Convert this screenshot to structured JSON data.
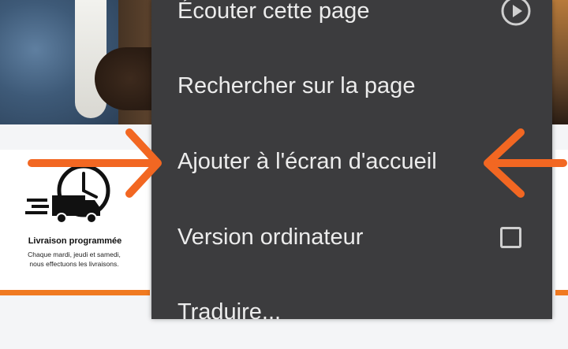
{
  "background_page": {
    "card": {
      "title": "Livraison programmée",
      "description": "Chaque mardi, jeudi et samedi, nous effectuons les livraisons."
    }
  },
  "menu": {
    "items": [
      {
        "label": "Écouter cette page",
        "trailing": "play-circle-icon"
      },
      {
        "label": "Rechercher sur la page"
      },
      {
        "label": "Ajouter à l'écran d'accueil"
      },
      {
        "label": "Version ordinateur",
        "trailing": "checkbox",
        "checked": false
      },
      {
        "label": "Traduire..."
      }
    ]
  },
  "colors": {
    "menu_background": "#3c3c3e",
    "menu_text": "#ececec",
    "annotation_arrow": "#f26722",
    "card_accent": "#f07a21"
  }
}
